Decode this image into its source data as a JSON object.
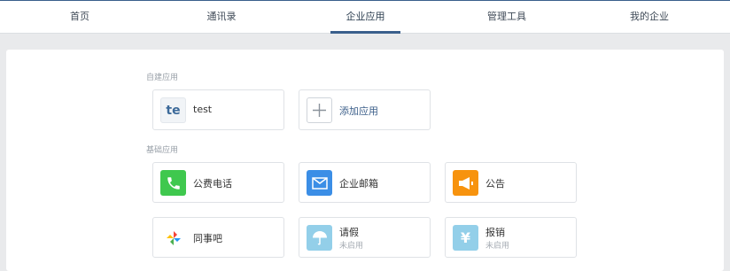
{
  "nav": {
    "tabs": [
      {
        "label": "首页"
      },
      {
        "label": "通讯录"
      },
      {
        "label": "企业应用",
        "active": true
      },
      {
        "label": "管理工具"
      },
      {
        "label": "我的企业"
      }
    ],
    "accent_color": "#3a5f8c"
  },
  "custom_apps": {
    "title": "自建应用",
    "items": [
      {
        "icon_text": "te",
        "name": "test"
      },
      {
        "name": "添加应用",
        "icon": "plus-icon"
      }
    ]
  },
  "basic_apps": {
    "title": "基础应用",
    "items": [
      {
        "name": "公费电话",
        "icon": "phone-icon",
        "color": "#3fc84e"
      },
      {
        "name": "企业邮箱",
        "icon": "mail-icon",
        "color": "#3b8ee6"
      },
      {
        "name": "公告",
        "icon": "megaphone-icon",
        "color": "#f7930e"
      },
      {
        "name": "同事吧",
        "icon": "pinwheel-icon"
      },
      {
        "name": "请假",
        "sub": "未启用",
        "icon": "umbrella-icon",
        "color": "#93cfe9"
      },
      {
        "name": "报销",
        "sub": "未启用",
        "icon": "yen-icon",
        "color": "#93cfe9"
      }
    ]
  }
}
